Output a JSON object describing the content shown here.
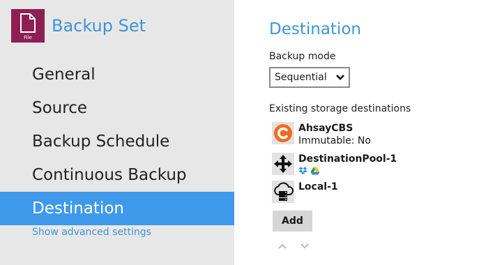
{
  "app": {
    "title": "Backup Set",
    "icon_label": "File",
    "brand_color": "#8e1f52",
    "accent_color": "#3f99ea"
  },
  "sidebar": {
    "items": [
      {
        "label": "General",
        "active": false
      },
      {
        "label": "Source",
        "active": false
      },
      {
        "label": "Backup Schedule",
        "active": false
      },
      {
        "label": "Continuous Backup",
        "active": false
      },
      {
        "label": "Destination",
        "active": true
      }
    ],
    "advanced_link": "Show advanced settings"
  },
  "main": {
    "title": "Destination",
    "backup_mode": {
      "label": "Backup mode",
      "selected": "Sequential"
    },
    "destinations": {
      "label": "Existing storage destinations",
      "items": [
        {
          "name": "AhsayCBS",
          "sub": "Immutable: No",
          "icon": "ahsay-c-icon"
        },
        {
          "name": "DestinationPool-1",
          "sub": "",
          "icon": "move-arrows-icon",
          "mini_icons": [
            "dropbox-icon",
            "google-drive-icon"
          ]
        },
        {
          "name": "Local-1",
          "sub": "",
          "icon": "local-cloud-drive-icon"
        }
      ]
    },
    "add_button": "Add"
  }
}
